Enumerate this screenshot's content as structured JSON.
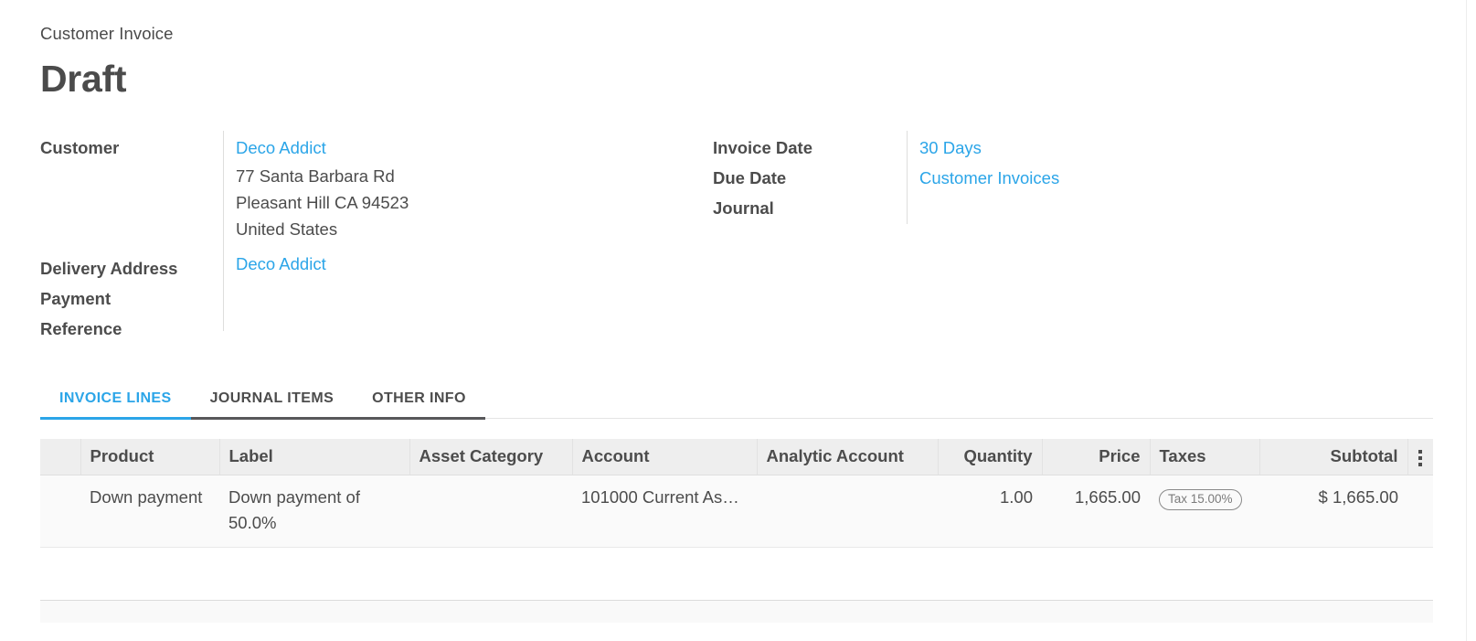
{
  "header": {
    "breadcrumb": "Customer Invoice",
    "status": "Draft"
  },
  "form": {
    "left": {
      "labels": {
        "customer": "Customer",
        "delivery_address": "Delivery Address",
        "payment_reference": "Payment Reference"
      },
      "values": {
        "customer_name": "Deco Addict",
        "address_line1": "77 Santa Barbara Rd",
        "address_line2": "Pleasant Hill CA 94523",
        "address_line3": "United States",
        "delivery_address": "Deco Addict",
        "payment_reference": ""
      }
    },
    "right": {
      "labels": {
        "invoice_date": "Invoice Date",
        "due_date": "Due Date",
        "journal": "Journal"
      },
      "values": {
        "invoice_date": "",
        "due_date": "30 Days",
        "journal": "Customer Invoices"
      }
    }
  },
  "notebook": {
    "tabs": [
      {
        "label": "INVOICE LINES",
        "active": true
      },
      {
        "label": "JOURNAL ITEMS",
        "active": false
      },
      {
        "label": "OTHER INFO",
        "active": false
      }
    ]
  },
  "lines_table": {
    "columns": [
      "Product",
      "Label",
      "Asset Category",
      "Account",
      "Analytic Account",
      "Quantity",
      "Price",
      "Taxes",
      "Subtotal"
    ],
    "options_icon": "vertical-dots-icon",
    "rows": [
      {
        "product": "Down payment",
        "label": "Down payment of 50.0%",
        "asset_category": "",
        "account": "101000 Current As…",
        "analytic_account": "",
        "quantity": "1.00",
        "price": "1,665.00",
        "taxes": "Tax 15.00%",
        "subtotal": "$ 1,665.00"
      }
    ]
  },
  "colors": {
    "link": "#2ba5e8",
    "text": "#4c4c4c",
    "header_bg": "#eeeeee",
    "row_bg": "#fafafa"
  }
}
